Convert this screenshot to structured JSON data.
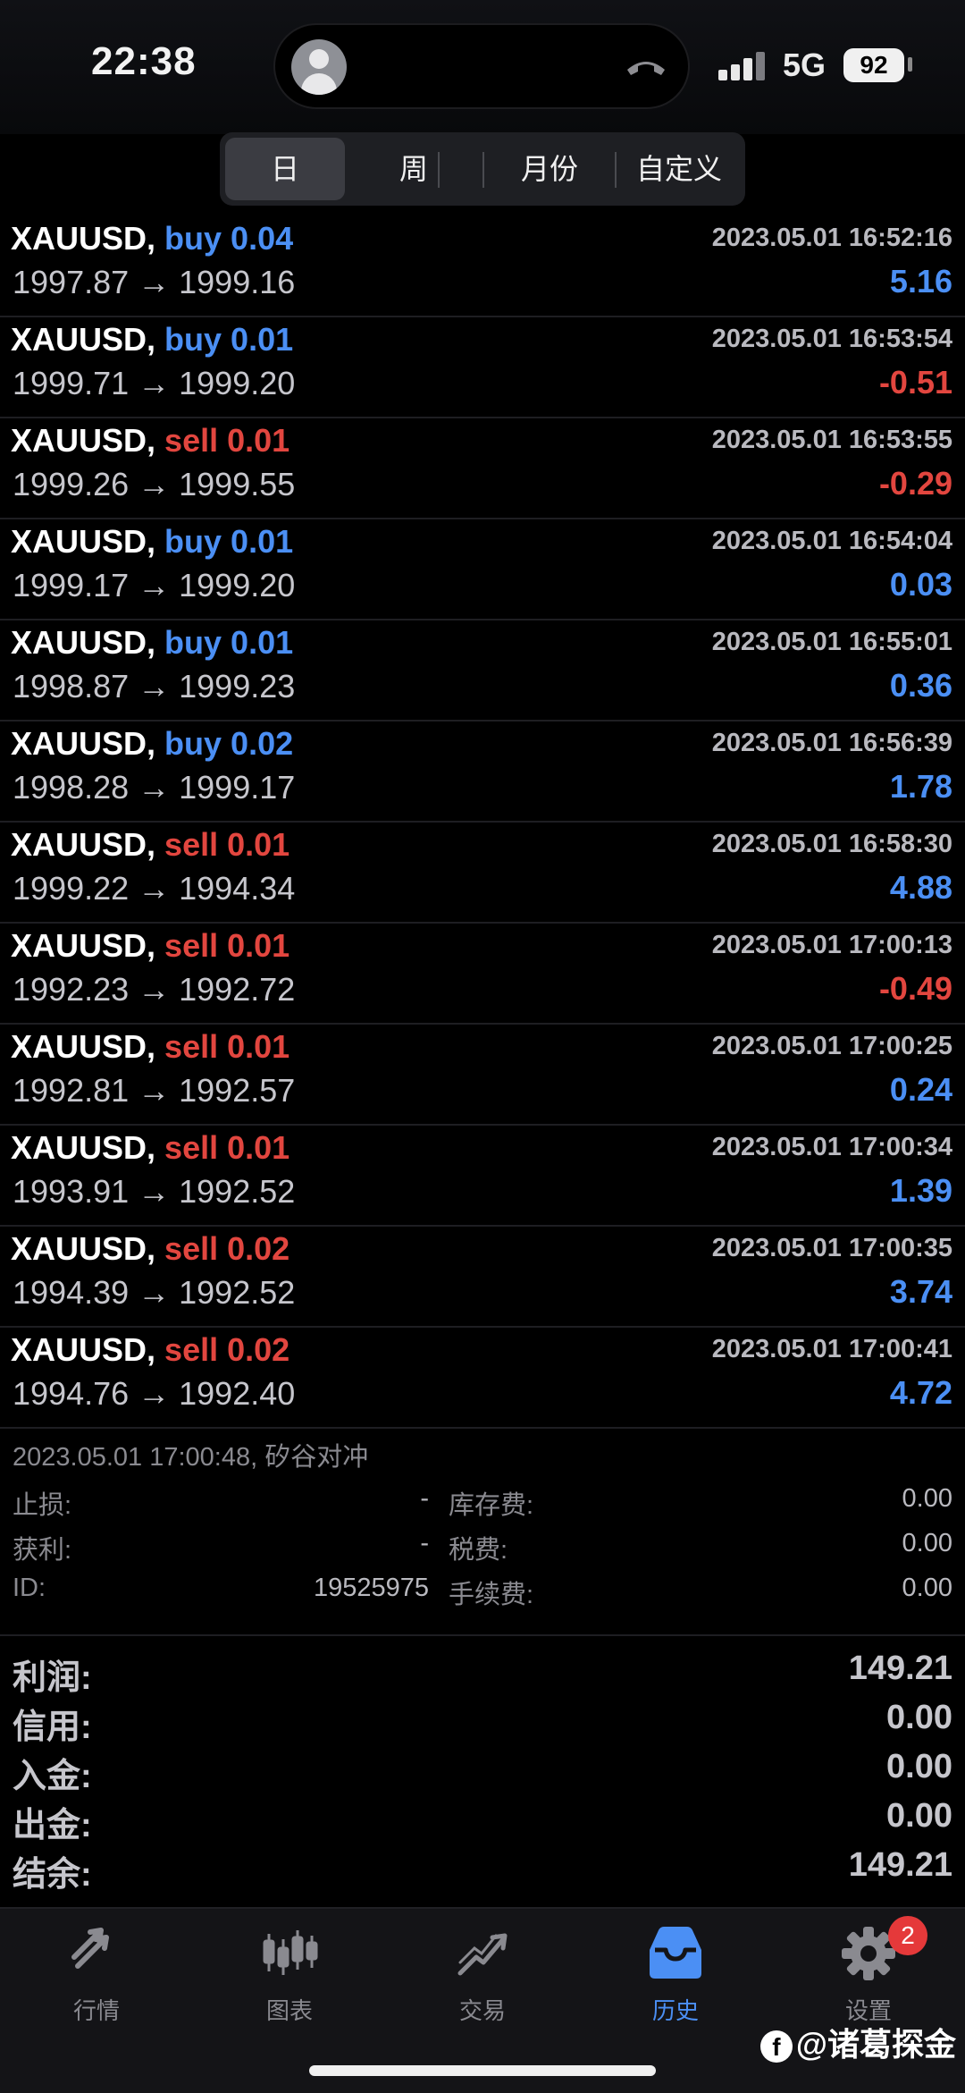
{
  "status_bar": {
    "time": "22:38",
    "network": "5G",
    "battery": "92"
  },
  "tabs": [
    "日",
    "周",
    "月份",
    "自定义"
  ],
  "trades": [
    {
      "symbol": "XAUUSD,",
      "side": "buy",
      "lot": "buy 0.04",
      "time": "2023.05.01 16:52:16",
      "prices": "1997.87 → 1999.16",
      "profit": "5.16"
    },
    {
      "symbol": "XAUUSD,",
      "side": "buy",
      "lot": "buy 0.01",
      "time": "2023.05.01 16:53:54",
      "prices": "1999.71 → 1999.20",
      "profit": "-0.51"
    },
    {
      "symbol": "XAUUSD,",
      "side": "sell",
      "lot": "sell 0.01",
      "time": "2023.05.01 16:53:55",
      "prices": "1999.26 → 1999.55",
      "profit": "-0.29"
    },
    {
      "symbol": "XAUUSD,",
      "side": "buy",
      "lot": "buy 0.01",
      "time": "2023.05.01 16:54:04",
      "prices": "1999.17 → 1999.20",
      "profit": "0.03"
    },
    {
      "symbol": "XAUUSD,",
      "side": "buy",
      "lot": "buy 0.01",
      "time": "2023.05.01 16:55:01",
      "prices": "1998.87 → 1999.23",
      "profit": "0.36"
    },
    {
      "symbol": "XAUUSD,",
      "side": "buy",
      "lot": "buy 0.02",
      "time": "2023.05.01 16:56:39",
      "prices": "1998.28 → 1999.17",
      "profit": "1.78"
    },
    {
      "symbol": "XAUUSD,",
      "side": "sell",
      "lot": "sell 0.01",
      "time": "2023.05.01 16:58:30",
      "prices": "1999.22 → 1994.34",
      "profit": "4.88"
    },
    {
      "symbol": "XAUUSD,",
      "side": "sell",
      "lot": "sell 0.01",
      "time": "2023.05.01 17:00:13",
      "prices": "1992.23 → 1992.72",
      "profit": "-0.49"
    },
    {
      "symbol": "XAUUSD,",
      "side": "sell",
      "lot": "sell 0.01",
      "time": "2023.05.01 17:00:25",
      "prices": "1992.81 → 1992.57",
      "profit": "0.24"
    },
    {
      "symbol": "XAUUSD,",
      "side": "sell",
      "lot": "sell 0.01",
      "time": "2023.05.01 17:00:34",
      "prices": "1993.91 → 1992.52",
      "profit": "1.39"
    },
    {
      "symbol": "XAUUSD,",
      "side": "sell",
      "lot": "sell 0.02",
      "time": "2023.05.01 17:00:35",
      "prices": "1994.39 → 1992.52",
      "profit": "3.74"
    },
    {
      "symbol": "XAUUSD,",
      "side": "sell",
      "lot": "sell 0.02",
      "time": "2023.05.01 17:00:41",
      "prices": "1994.76 → 1992.40",
      "profit": "4.72"
    }
  ],
  "detail": {
    "header": "2023.05.01 17:00:48, 矽谷对冲",
    "rows": [
      {
        "k1": "止损:",
        "v1": "-",
        "k2": "库存费:",
        "v2": "0.00"
      },
      {
        "k1": "获利:",
        "v1": "-",
        "k2": "税费:",
        "v2": "0.00"
      },
      {
        "k1": "ID:",
        "v1": "19525975",
        "k2": "手续费:",
        "v2": "0.00"
      }
    ]
  },
  "summary": [
    {
      "k": "利润:",
      "v": "149.21"
    },
    {
      "k": "信用:",
      "v": "0.00"
    },
    {
      "k": "入金:",
      "v": "0.00"
    },
    {
      "k": "出金:",
      "v": "0.00"
    },
    {
      "k": "结余:",
      "v": "149.21"
    }
  ],
  "nav": [
    {
      "label": "行情",
      "icon": "quotes-icon"
    },
    {
      "label": "图表",
      "icon": "chart-icon"
    },
    {
      "label": "交易",
      "icon": "trade-icon"
    },
    {
      "label": "历史",
      "icon": "history-icon"
    },
    {
      "label": "设置",
      "icon": "settings-icon",
      "badge": "2"
    }
  ],
  "watermark": "@诸葛探金",
  "colors": {
    "buy": "#4b8ff4",
    "sell": "#e2463f",
    "accent": "#4b8ff4",
    "badge": "#e5393a"
  }
}
